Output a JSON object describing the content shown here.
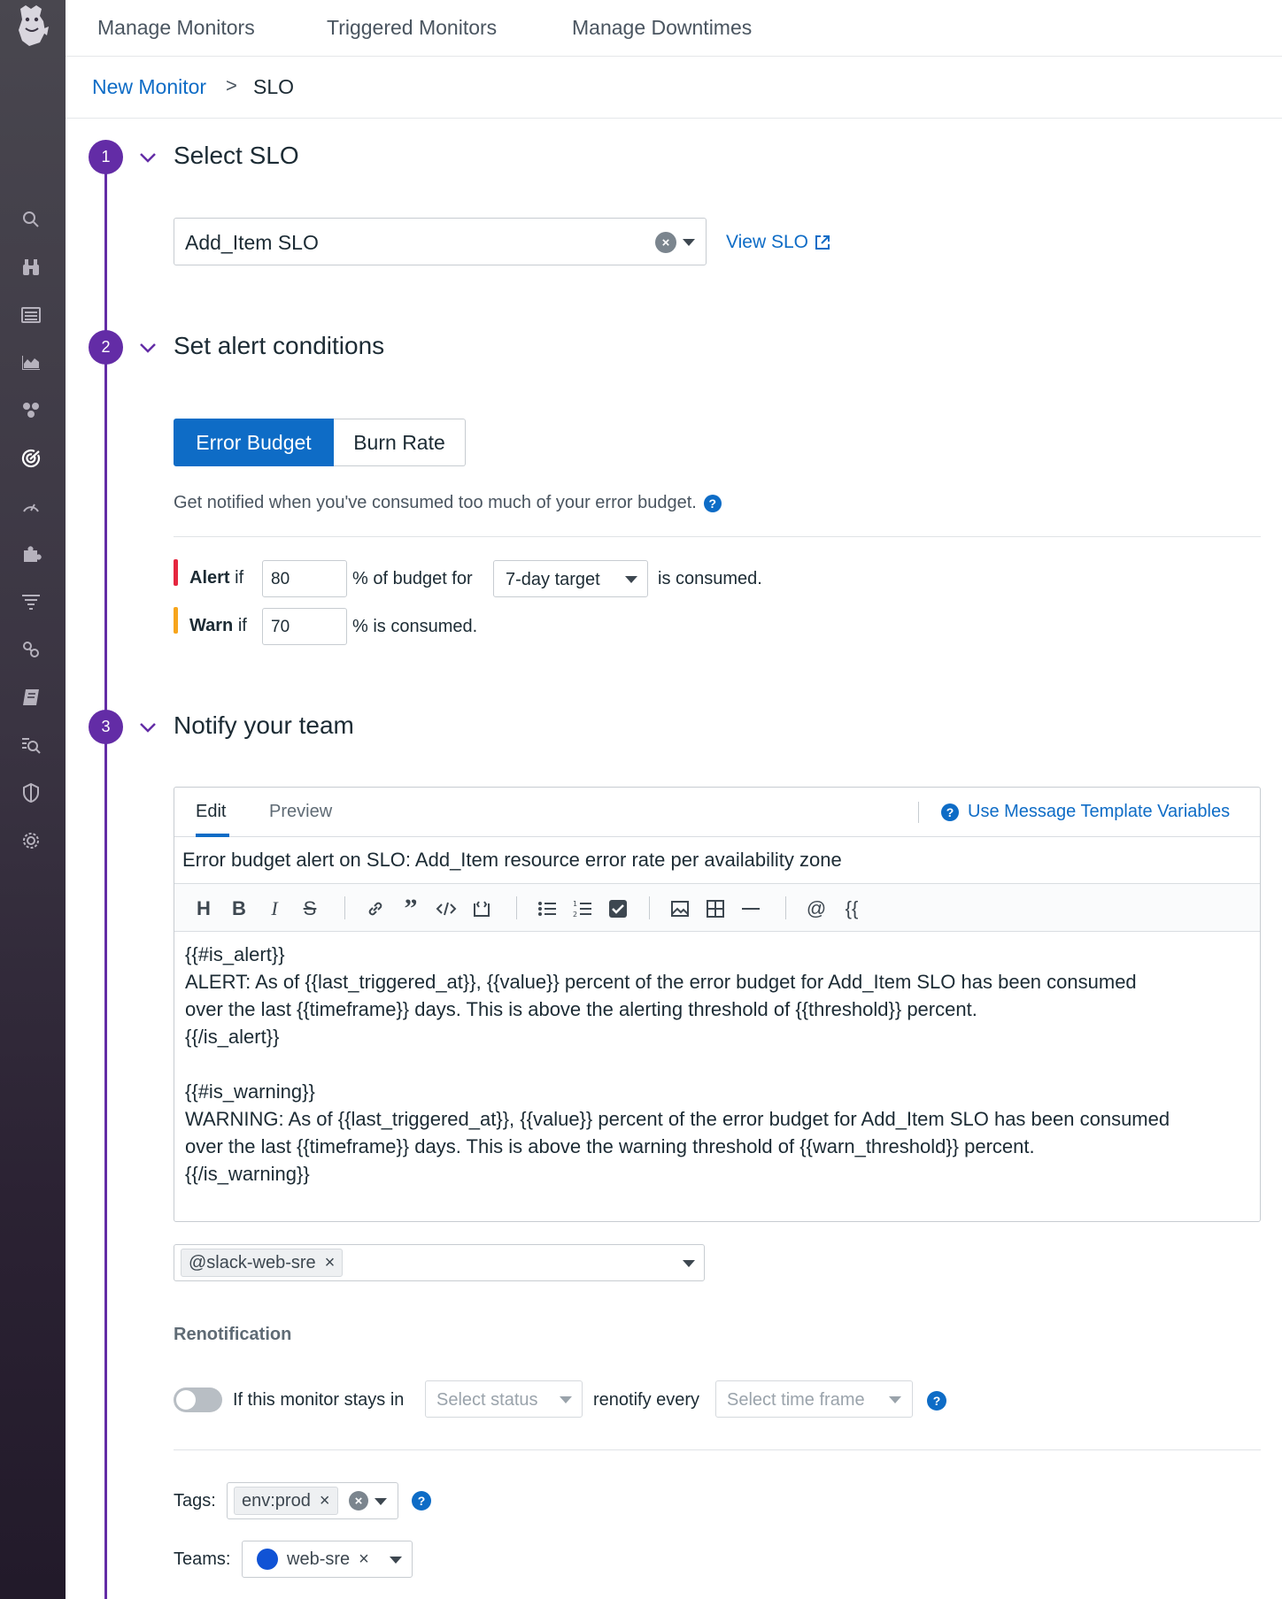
{
  "nav": {
    "manage_monitors": "Manage Monitors",
    "triggered_monitors": "Triggered Monitors",
    "manage_downtimes": "Manage Downtimes"
  },
  "breadcrumb": {
    "parent": "New Monitor",
    "separator": ">",
    "current": "SLO"
  },
  "sidebar": {
    "items": [
      "search-icon",
      "binoculars-icon",
      "list-icon",
      "area-chart-icon",
      "hexagons-icon",
      "slo-target-icon",
      "gauge-icon",
      "puzzle-icon",
      "filter-lines-icon",
      "link-icon",
      "notebook-icon",
      "security-search-icon",
      "shield-icon",
      "settings-gear-icon"
    ],
    "active": "slo-target-icon"
  },
  "steps": {
    "one": {
      "number": "1",
      "title": "Select SLO"
    },
    "two": {
      "number": "2",
      "title": "Set alert conditions"
    },
    "three": {
      "number": "3",
      "title": "Notify your team"
    }
  },
  "select_slo": {
    "value": "Add_Item SLO",
    "view_link": "View SLO"
  },
  "alert_conditions": {
    "tab_error_budget": "Error Budget",
    "tab_burn_rate": "Burn Rate",
    "hint": "Get notified when you've consumed too much of your error budget.",
    "alert_strong": "Alert",
    "warn_strong": "Warn",
    "if_word": "if",
    "alert_value": "80",
    "alert_suffix": "% of budget for",
    "target_value": "7-day target",
    "alert_tail": "is consumed.",
    "warn_value": "70",
    "warn_suffix": "% is consumed.",
    "alert_color": "#e5263f",
    "warn_color": "#f7a51c"
  },
  "editor": {
    "tab_edit": "Edit",
    "tab_preview": "Preview",
    "template_vars": "Use Message Template Variables",
    "subject": "Error budget alert on SLO: Add_Item resource error rate per availability zone",
    "toolbar": [
      "heading",
      "bold",
      "italic",
      "strikethrough",
      "link",
      "quote",
      "code",
      "code-block",
      "bulleted-list",
      "numbered-list",
      "checkbox",
      "image",
      "table",
      "horizontal-rule",
      "mention",
      "template-variable"
    ],
    "body": "{{#is_alert}}\nALERT: As of {{last_triggered_at}}, {{value}} percent of the error budget for Add_Item SLO has been consumed\nover the last {{timeframe}} days. This is above the alerting threshold of {{threshold}} percent.\n{{/is_alert}}\n\n{{#is_warning}}\nWARNING: As of {{last_triggered_at}}, {{value}} percent of the error budget for Add_Item SLO has been consumed\nover the last {{timeframe}} days. This is above the warning threshold of {{warn_threshold}} percent.\n{{/is_warning}}"
  },
  "recipients": {
    "chip": "@slack-web-sre"
  },
  "renotification": {
    "title": "Renotification",
    "toggle_on": false,
    "label_stays": "If this monitor stays in",
    "status_placeholder": "Select status",
    "label_every": "renotify every",
    "timeframe_placeholder": "Select time frame"
  },
  "tags": {
    "label": "Tags:",
    "chip": "env:prod"
  },
  "teams": {
    "label": "Teams:",
    "chip": "web-sre",
    "team_color": "#1053d5"
  },
  "colors": {
    "accent": "#632ca6",
    "link": "#0e6cc6"
  }
}
